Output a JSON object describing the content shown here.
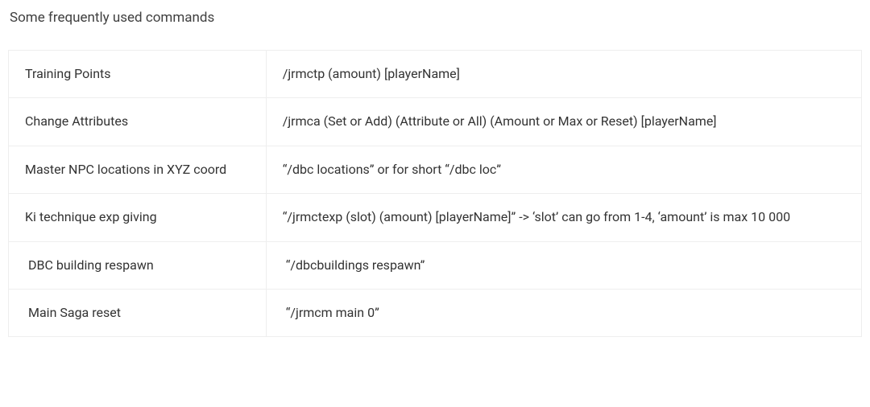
{
  "heading": "Some frequently used commands",
  "rows": [
    {
      "label": "Training Points",
      "value": "/jrmctp (amount) [playerName]"
    },
    {
      "label": "Change Attributes",
      "value": "/jrmca (Set or Add) (Attribute or All) (Amount or Max or Reset) [playerName]"
    },
    {
      "label": "Master NPC locations in XYZ coord",
      "value": "“/dbc locations” or for short “/dbc loc”"
    },
    {
      "label": "Ki technique exp giving",
      "value": "“/jrmctexp (slot) (amount) [playerName]” -> ‘slot’ can go from 1-4, ‘amount’ is max 10 000"
    },
    {
      "label": "DBC building respawn",
      "value": "“/dbcbuildings respawn”"
    },
    {
      "label": "Main Saga reset",
      "value": "“/jrmcm main 0”"
    }
  ]
}
